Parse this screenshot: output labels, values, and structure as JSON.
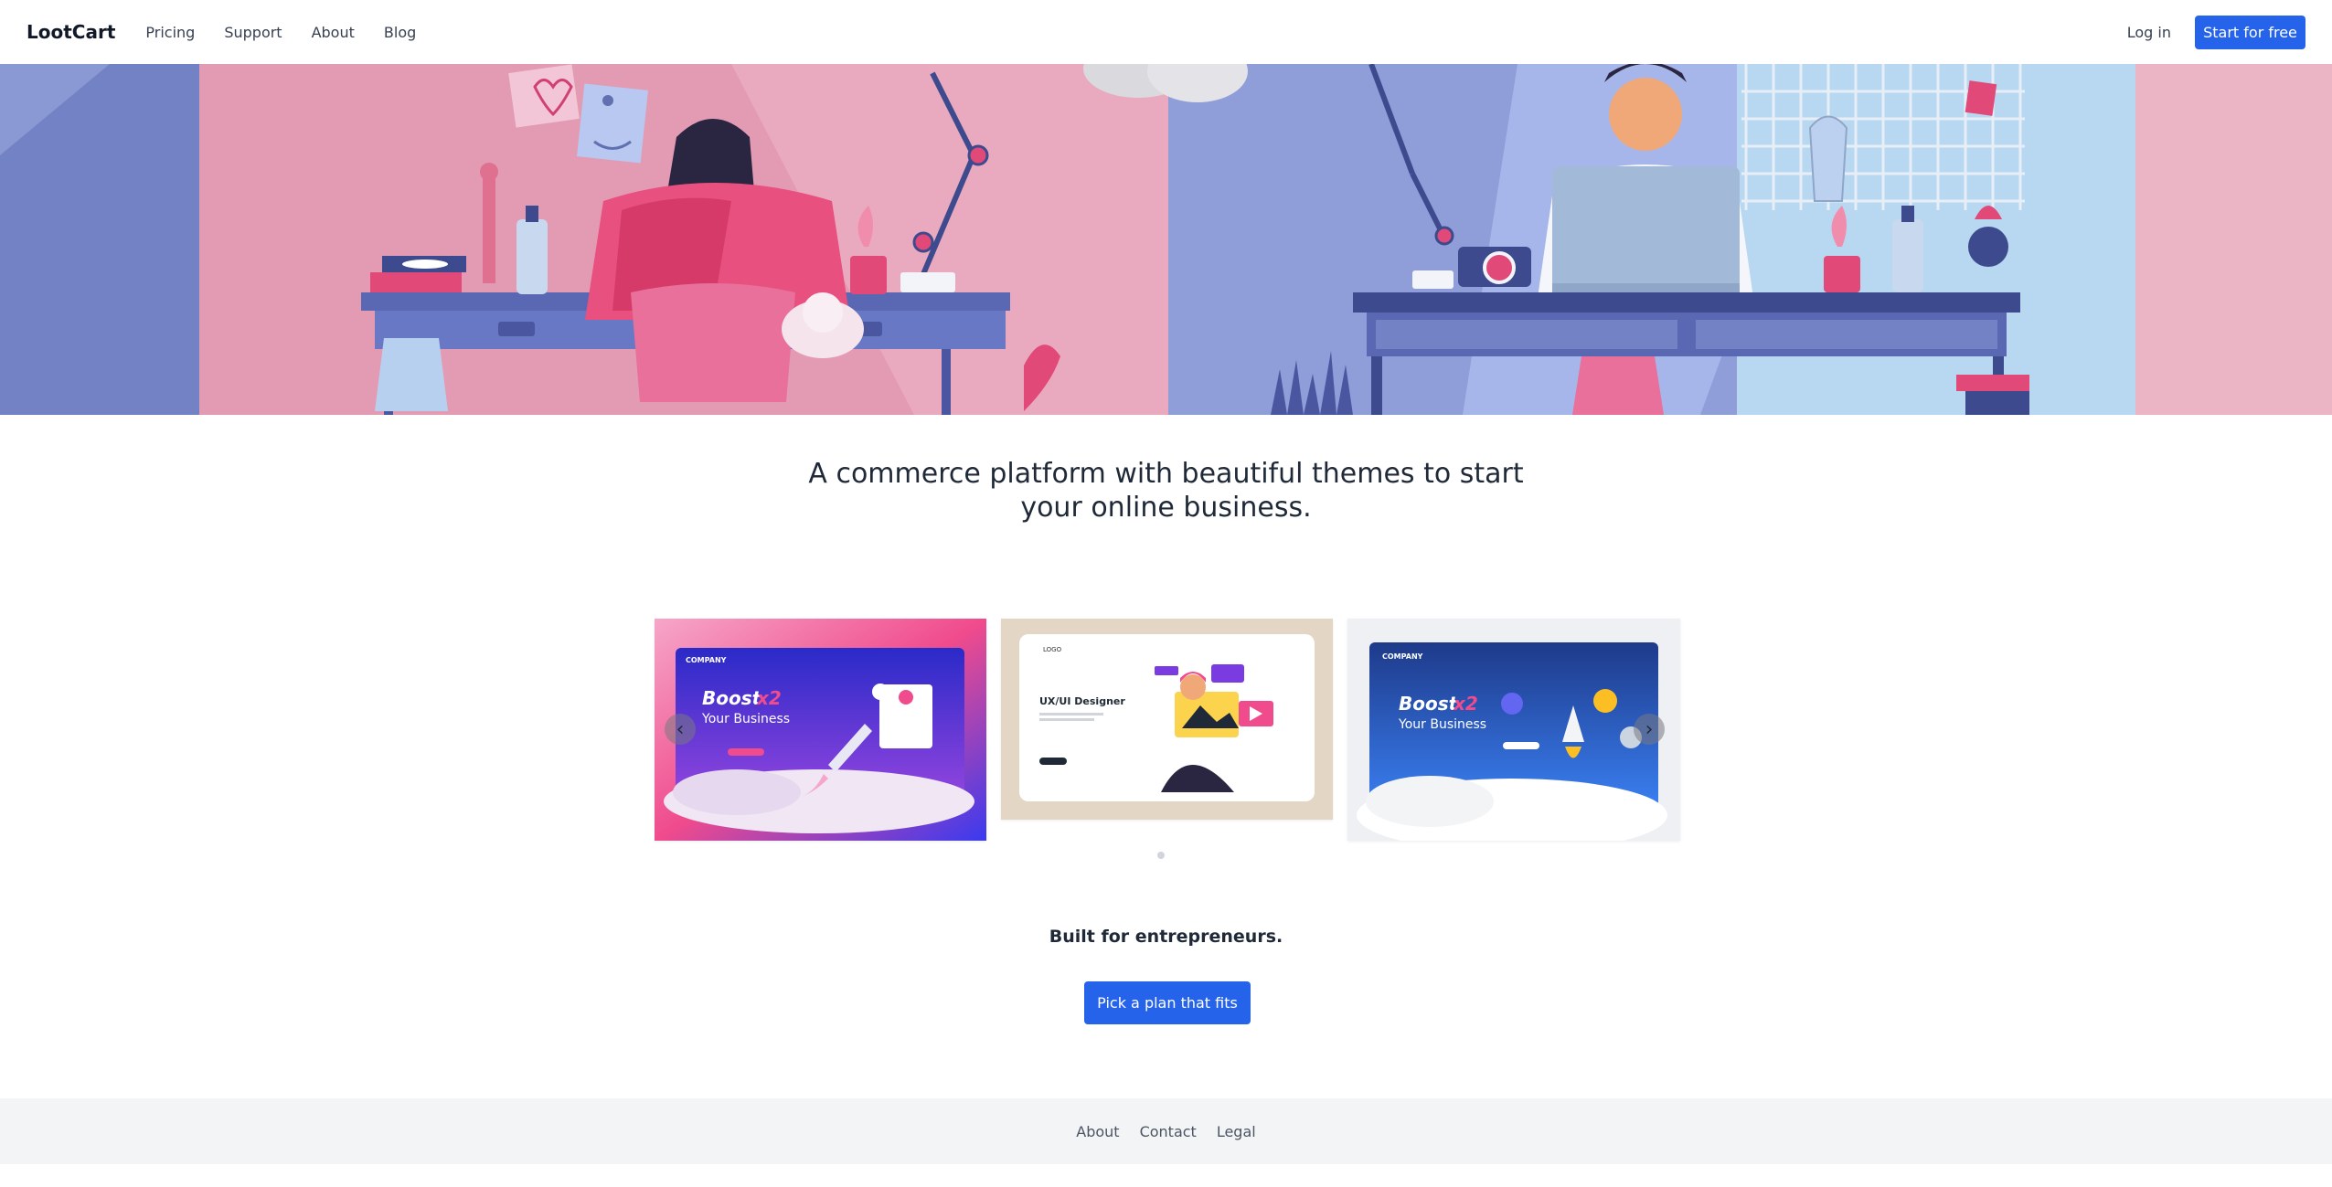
{
  "nav": {
    "brand": "LootCart",
    "links": [
      "Pricing",
      "Support",
      "About",
      "Blog"
    ],
    "login": "Log in",
    "start": "Start for free"
  },
  "headline": "A commerce platform with beautiful themes to start your online business.",
  "carousel": {
    "slide1": {
      "company": "COMPANY",
      "title_a": "Boost",
      "title_x": "x2",
      "title_b": "Your Business"
    },
    "slide2": {
      "logo": "LOGO",
      "title": "UX/UI Designer"
    },
    "slide3": {
      "company": "COMPANY",
      "title_a": "Boost",
      "title_x": "x2",
      "title_b": "Your Business"
    },
    "prev_icon": "chevron-left-icon",
    "next_icon": "chevron-right-icon"
  },
  "cta": {
    "text": "Built for entrepreneurs.",
    "button": "Pick a plan that fits"
  },
  "footer": {
    "links": [
      "About",
      "Contact",
      "Legal"
    ]
  },
  "colors": {
    "primary": "#2563eb",
    "footer_bg": "#f3f4f6"
  }
}
